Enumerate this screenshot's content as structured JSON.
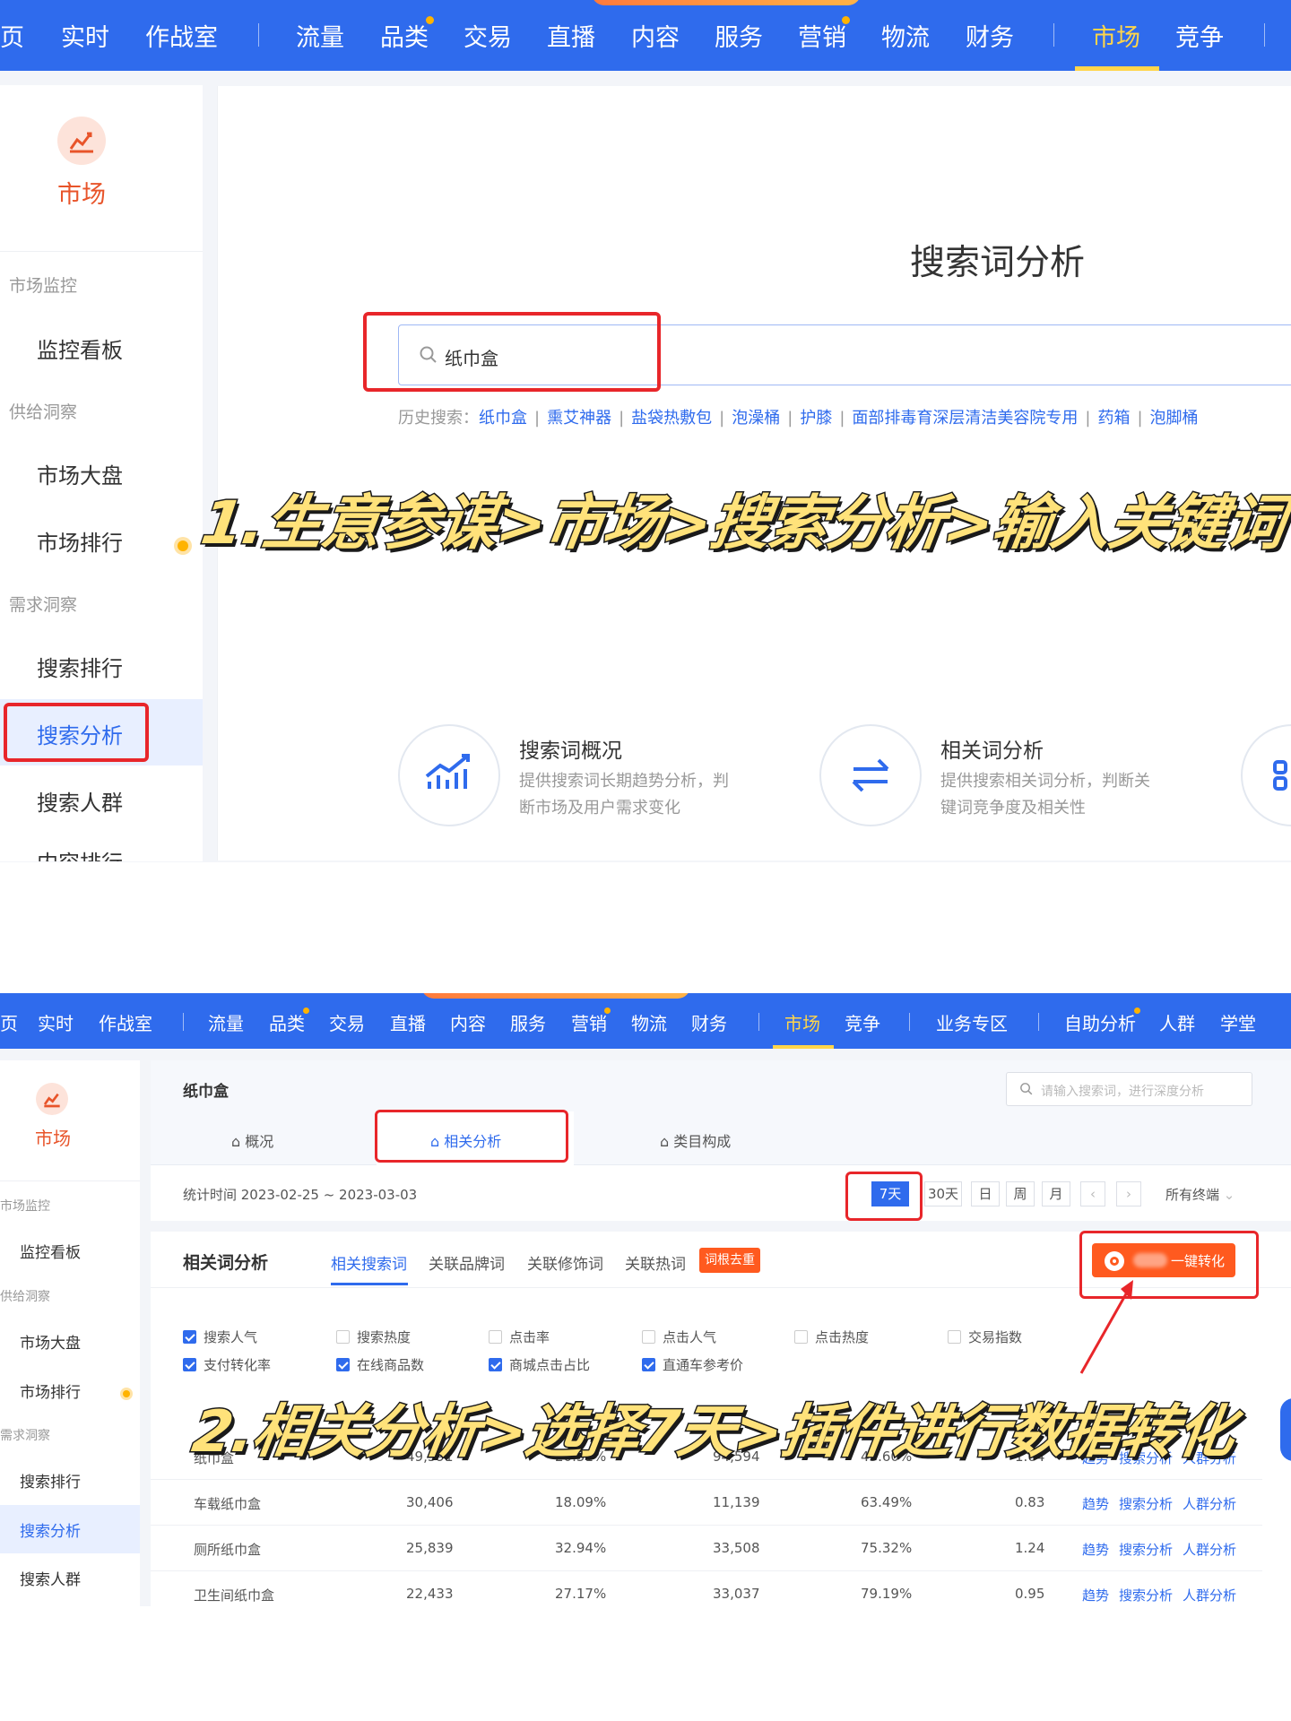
{
  "panel1": {
    "nav": {
      "items": [
        "页",
        "实时",
        "作战室",
        "流量",
        "品类",
        "交易",
        "直播",
        "内容",
        "服务",
        "营销",
        "物流",
        "财务",
        "市场",
        "竞争"
      ],
      "active": "市场"
    },
    "sidebar": {
      "module": "市场",
      "group_monitor": "市场监控",
      "item_monitor_board": "监控看板",
      "group_supply": "供给洞察",
      "item_market_overview": "市场大盘",
      "item_market_rank": "市场排行",
      "group_demand": "需求洞察",
      "item_search_rank": "搜索排行",
      "item_search_analysis": "搜索分析",
      "item_search_crowd": "搜索人群",
      "item_partial": "内容排行"
    },
    "page_title": "搜索词分析",
    "search_value": "纸巾盒",
    "history_label": "历史搜索：",
    "history": [
      "纸巾盒",
      "熏艾神器",
      "盐袋热敷包",
      "泡澡桶",
      "护膝",
      "面部排毒育深层清洁美容院专用",
      "药箱",
      "泡脚桶"
    ],
    "cards": [
      {
        "title": "搜索词概况",
        "desc_1": "提供搜索词长期趋势分析，判",
        "desc_2": "断市场及用户需求变化",
        "icon": "trend-chart-icon"
      },
      {
        "title": "相关词分析",
        "desc_1": "提供搜索相关词分析，判断关",
        "desc_2": "键词竞争度及相关性",
        "icon": "swap-arrows-icon"
      }
    ],
    "caption": "1.生意参谋>市场>搜索分析>输入关键词"
  },
  "panel2": {
    "nav": {
      "items": [
        "页",
        "实时",
        "作战室",
        "流量",
        "品类",
        "交易",
        "直播",
        "内容",
        "服务",
        "营销",
        "物流",
        "财务",
        "市场",
        "竞争",
        "业务专区",
        "自助分析",
        "人群",
        "学堂"
      ],
      "active": "市场"
    },
    "sidebar": {
      "module": "市场",
      "group_monitor": "市场监控",
      "item_monitor_board": "监控看板",
      "group_supply": "供给洞察",
      "item_market_overview": "市场大盘",
      "item_market_rank": "市场排行",
      "group_demand": "需求洞察",
      "item_search_rank": "搜索排行",
      "item_search_analysis": "搜索分析",
      "item_search_crowd": "搜索人群"
    },
    "keyword": "纸巾盒",
    "search_placeholder": "请输入搜索词，进行深度分析",
    "tabs": [
      "概况",
      "相关分析",
      "类目构成"
    ],
    "stat_time": "统计时间 2023-02-25 ~ 2023-03-03",
    "time_buttons": [
      "7天",
      "30天",
      "日",
      "周",
      "月"
    ],
    "terminal": "所有终端",
    "section_title": "相关词分析",
    "subtabs": [
      "相关搜索词",
      "关联品牌词",
      "关联修饰词",
      "关联热词"
    ],
    "tag_badge": "词根去重",
    "plugin_button": "一键转化",
    "checkboxes_row1": [
      {
        "label": "搜索人气",
        "checked": true
      },
      {
        "label": "搜索热度",
        "checked": false
      },
      {
        "label": "点击率",
        "checked": false
      },
      {
        "label": "点击人气",
        "checked": false
      },
      {
        "label": "点击热度",
        "checked": false
      },
      {
        "label": "交易指数",
        "checked": false
      }
    ],
    "checkboxes_row2": [
      {
        "label": "支付转化率",
        "checked": true
      },
      {
        "label": "在线商品数",
        "checked": true
      },
      {
        "label": "商城点击占比",
        "checked": true
      },
      {
        "label": "直通车参考价",
        "checked": true
      }
    ],
    "rows": [
      {
        "word": "纸巾盒",
        "popularity": "49,591",
        "conversion": "20.51%",
        "online_items": "94,594",
        "mall_click": "45.60%",
        "cpc": "1.04"
      },
      {
        "word": "车载纸巾盒",
        "popularity": "30,406",
        "conversion": "18.09%",
        "online_items": "11,139",
        "mall_click": "63.49%",
        "cpc": "0.83"
      },
      {
        "word": "厕所纸巾盒",
        "popularity": "25,839",
        "conversion": "32.94%",
        "online_items": "33,508",
        "mall_click": "75.32%",
        "cpc": "1.24"
      },
      {
        "word": "卫生间纸巾盒",
        "popularity": "22,433",
        "conversion": "27.17%",
        "online_items": "33,037",
        "mall_click": "79.19%",
        "cpc": "0.95"
      }
    ],
    "row_links": [
      "趋势",
      "搜索分析",
      "人群分析"
    ],
    "caption": "2.相关分析>选择7天>插件进行数据转化"
  },
  "colors": {
    "nav_blue": "#2f6bed",
    "accent_orange": "#ff5a1f",
    "highlight_red": "#e8262a",
    "caption_yellow": "#ffe27a"
  }
}
